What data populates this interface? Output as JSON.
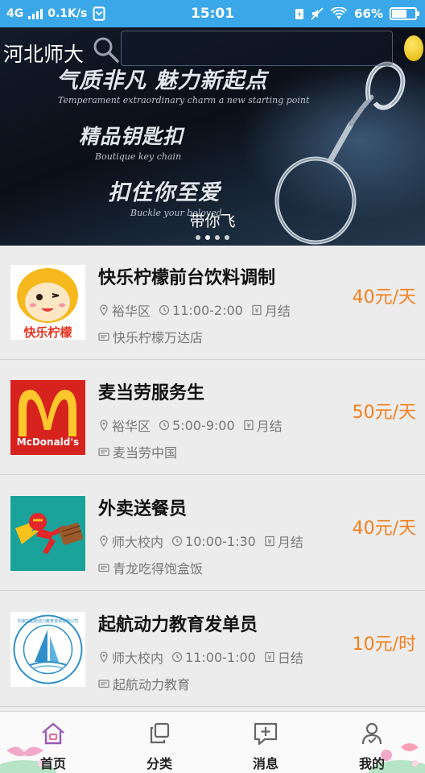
{
  "status_bar": {
    "network": "4G",
    "speed": "0.1K/s",
    "time": "15:01",
    "battery": "66%",
    "battery_level": 0.66,
    "icons": [
      "signal-icon",
      "sim-icon",
      "battery-saver-icon",
      "mute-icon",
      "wifi-icon",
      "battery-icon"
    ]
  },
  "header": {
    "city": "河北师大",
    "search_placeholder": "",
    "icons": [
      "search-icon",
      "lemon-icon"
    ]
  },
  "banner": {
    "caption": "带你飞",
    "slides": 4,
    "active_slide": 1,
    "promo_lines": [
      "气质非凡 魅力新起点",
      "精品钥匙扣",
      "扣住你至爱"
    ],
    "promo_sub_lines": [
      "Temperament extraordinary charm a new starting point",
      "Boutique key chain",
      "Buckle your beloved"
    ]
  },
  "colors": {
    "status_bar": "#3aa7e9",
    "wage": "#f2801e",
    "list_bg": "#ececec"
  },
  "jobs": [
    {
      "title": "快乐柠檬前台饮料调制",
      "area": "裕华区",
      "time": "11:00-2:00",
      "pay_cycle": "月结",
      "shop": "快乐柠檬万达店",
      "wage": "40元/天",
      "logo": "happy-lemon-logo",
      "logo_text": "快乐柠檬"
    },
    {
      "title": "麦当劳服务生",
      "area": "裕华区",
      "time": "5:00-9:00",
      "pay_cycle": "月结",
      "shop": "麦当劳中国",
      "wage": "50元/天",
      "logo": "mcdonalds-logo",
      "logo_text": "McDonald's"
    },
    {
      "title": "外卖送餐员",
      "area": "师大校内",
      "time": "10:00-1:30",
      "pay_cycle": "月结",
      "shop": "青龙吃得饱盒饭",
      "wage": "40元/天",
      "logo": "delivery-superhero-logo",
      "logo_text": ""
    },
    {
      "title": "起航动力教育发单员",
      "area": "师大校内",
      "time": "11:00-1:00",
      "pay_cycle": "日结",
      "shop": "起航动力教育",
      "wage": "10元/时",
      "logo": "qihang-education-logo",
      "logo_text": "石家庄起航动力教育咨询有限公司"
    }
  ],
  "tabs": [
    {
      "label": "首页",
      "icon": "home-icon",
      "active": true
    },
    {
      "label": "分类",
      "icon": "category-icon",
      "active": false
    },
    {
      "label": "消息",
      "icon": "message-icon",
      "active": false
    },
    {
      "label": "我的",
      "icon": "profile-icon",
      "active": false
    }
  ]
}
